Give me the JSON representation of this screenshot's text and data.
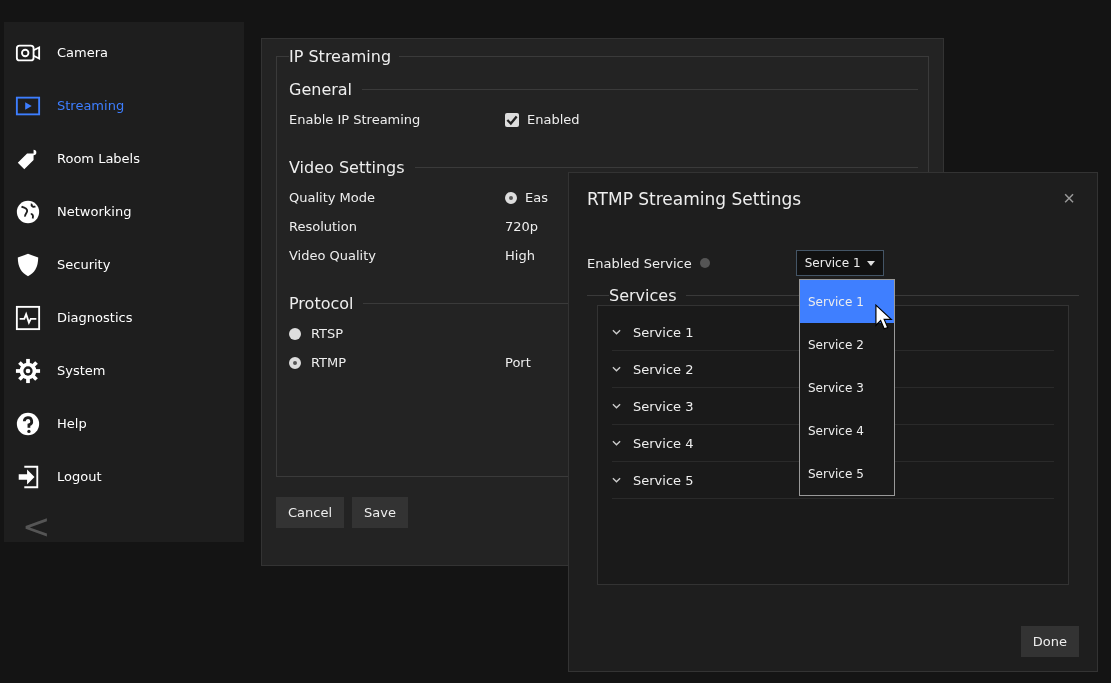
{
  "sidebar": {
    "items": [
      {
        "label": "Camera",
        "selected": false
      },
      {
        "label": "Streaming",
        "selected": true
      },
      {
        "label": "Room Labels",
        "selected": false
      },
      {
        "label": "Networking",
        "selected": false
      },
      {
        "label": "Security",
        "selected": false
      },
      {
        "label": "Diagnostics",
        "selected": false
      },
      {
        "label": "System",
        "selected": false
      },
      {
        "label": "Help",
        "selected": false
      },
      {
        "label": "Logout",
        "selected": false
      }
    ],
    "collapse": "<"
  },
  "panel": {
    "title": "IP Streaming",
    "general": {
      "title": "General",
      "label": "Enable IP Streaming",
      "checkbox": {
        "label": "Enabled",
        "checked": true
      }
    },
    "video": {
      "title": "Video Settings",
      "rows": [
        {
          "label": "Quality Mode",
          "kind": "radio",
          "value": "Eas",
          "checked": true
        },
        {
          "label": "Resolution",
          "kind": "text",
          "value": "720p"
        },
        {
          "label": "Video Quality",
          "kind": "text",
          "value": "High"
        }
      ]
    },
    "protocol": {
      "title": "Protocol",
      "options": [
        {
          "label": "RTSP",
          "selected": false
        },
        {
          "label": "RTMP",
          "selected": true,
          "extra": "Port"
        }
      ]
    },
    "buttons": [
      "Cancel",
      "Save"
    ]
  },
  "dialog": {
    "title": "RTMP Streaming Settings",
    "close": "×",
    "field_label": "Enabled Service",
    "select_value": "Service 1",
    "services_title": "Services",
    "services": [
      {
        "label": "Service 1",
        "expanded": false
      },
      {
        "label": "Service 2",
        "expanded": false
      },
      {
        "label": "Service 3",
        "expanded": false
      },
      {
        "label": "Service 4",
        "expanded": false
      },
      {
        "label": "Service 5",
        "expanded": false
      }
    ],
    "options": [
      {
        "label": "Service 1",
        "selected": true
      },
      {
        "label": "Service 2",
        "selected": false
      },
      {
        "label": "Service 3",
        "selected": false
      },
      {
        "label": "Service 4",
        "selected": false
      },
      {
        "label": "Service 5",
        "selected": false
      }
    ],
    "done": "Done"
  }
}
